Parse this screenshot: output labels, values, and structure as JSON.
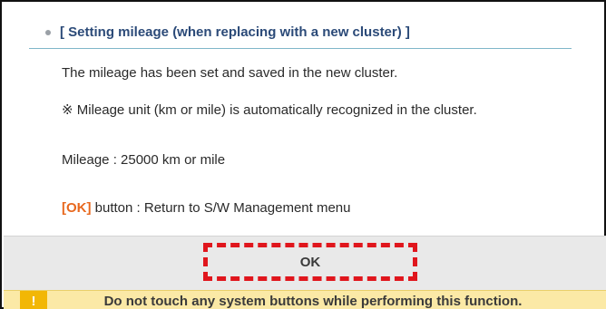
{
  "heading": "[ Setting mileage (when replacing with a new cluster) ]",
  "messages": {
    "saved": "The mileage has been set and saved in the new cluster.",
    "unit_note": "※ Mileage unit (km or mile) is automatically recognized in the cluster.",
    "mileage": "Mileage : 25000 km or mile",
    "ok_tag": "[OK]",
    "ok_desc": " button : Return to S/W Management menu"
  },
  "ok_button_label": "OK",
  "warning": {
    "icon": "!",
    "text": "Do not touch any system buttons while performing this function."
  },
  "colors": {
    "heading": "#2b4a78",
    "ok_tag": "#e8681e",
    "highlight": "#e0161d",
    "warning_bg": "#fbe9a6",
    "warning_icon": "#f2b705"
  }
}
